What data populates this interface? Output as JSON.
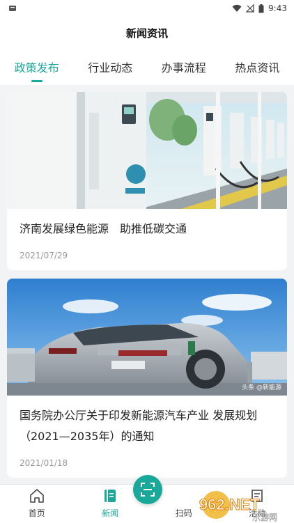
{
  "status_bar": {
    "time": "9:43"
  },
  "header": {
    "title": "新闻资讯"
  },
  "tabs": [
    {
      "label": "政策发布",
      "active": true
    },
    {
      "label": "行业动态",
      "active": false
    },
    {
      "label": "办事流程",
      "active": false
    },
    {
      "label": "热点资讯",
      "active": false
    }
  ],
  "articles": [
    {
      "title": "济南发展绿色能源　助推低碳交通",
      "date": "2021/07/29",
      "image": "ev-charging-stations"
    },
    {
      "title": "国务院办公厅关于印发新能源汽车产业 发展规划（2021—2035年）的通知",
      "date": "2021/01/18",
      "image": "electric-car-charging",
      "watermark": "头条 @新能源"
    }
  ],
  "bottom_nav": {
    "items": [
      {
        "label": "首页",
        "icon": "home-icon"
      },
      {
        "label": "新闻",
        "icon": "news-icon",
        "active": true
      },
      {
        "label": "扫码",
        "icon": "scan-icon"
      },
      {
        "label": "活动",
        "icon": "activity-icon"
      }
    ]
  },
  "brand_watermark": {
    "line1": "962.NET",
    "line2": "乐游网"
  },
  "colors": {
    "accent": "#1aa89a",
    "background": "#f2f3f5"
  }
}
